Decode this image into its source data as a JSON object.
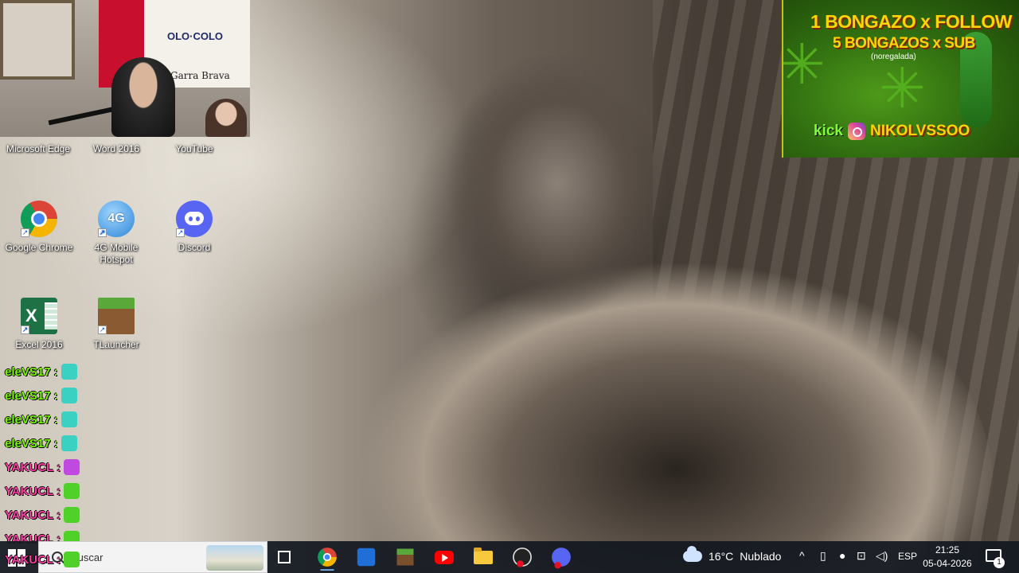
{
  "desktop_icons": [
    {
      "label": "Microsoft Edge"
    },
    {
      "label": "Word 2016"
    },
    {
      "label": "YouTube"
    },
    {
      "label": "Google Chrome"
    },
    {
      "label": "4G Mobile Hotspot",
      "glyph": "4G"
    },
    {
      "label": "Discord"
    },
    {
      "label": "Excel 2016",
      "glyph": "X"
    },
    {
      "label": "TLauncher"
    }
  ],
  "webcam": {
    "banner_text": "OLO·COLO",
    "banner_text2": "Garra Brava"
  },
  "promo": {
    "line1": "1 BONGAZO x FOLLOW",
    "line2": "5 BONGAZOS x SUB",
    "line3": "(noregalada)",
    "platform": "kick",
    "handle": "NIKOLVSSOO",
    "icon": "instagram-icon"
  },
  "chat": [
    {
      "user": "eleVS17",
      "sep": ":",
      "color": "#7cfc00",
      "emote_color": "#3ad1c2"
    },
    {
      "user": "eleVS17",
      "sep": ":",
      "color": "#7cfc00",
      "emote_color": "#3ad1c2"
    },
    {
      "user": "eleVS17",
      "sep": ":",
      "color": "#7cfc00",
      "emote_color": "#3ad1c2"
    },
    {
      "user": "eleVS17",
      "sep": ":",
      "color": "#7cfc00",
      "emote_color": "#3ad1c2"
    },
    {
      "user": "YAKUCL",
      "sep": ":",
      "color": "#ff3ea5",
      "emote_color": "#c04adf"
    },
    {
      "user": "YAKUCL",
      "sep": ":",
      "color": "#ff3ea5",
      "emote_color": "#4fd12a"
    },
    {
      "user": "YAKUCL",
      "sep": ":",
      "color": "#ff3ea5",
      "emote_color": "#4fd12a"
    },
    {
      "user": "YAKUCL",
      "sep": ":",
      "color": "#ff3ea5",
      "emote_color": "#4fd12a"
    },
    {
      "user": "YAKUCL",
      "sep": ":",
      "color": "#ff3ea5",
      "emote_color": "#4fd12a"
    }
  ],
  "taskbar": {
    "search_placeholder": "Buscar",
    "apps": [
      "task-view-icon",
      "chrome-icon",
      "store-icon",
      "minecraft-icon",
      "youtube-icon",
      "file-explorer-icon",
      "obs-icon",
      "discord-icon"
    ],
    "weather": {
      "temp": "16°C",
      "condition": "Nublado"
    },
    "tray": {
      "language": "ESP",
      "chevron": "^"
    },
    "clock": {
      "time": "21:25",
      "date": "05-04-2026"
    },
    "notifications_count": "1"
  }
}
